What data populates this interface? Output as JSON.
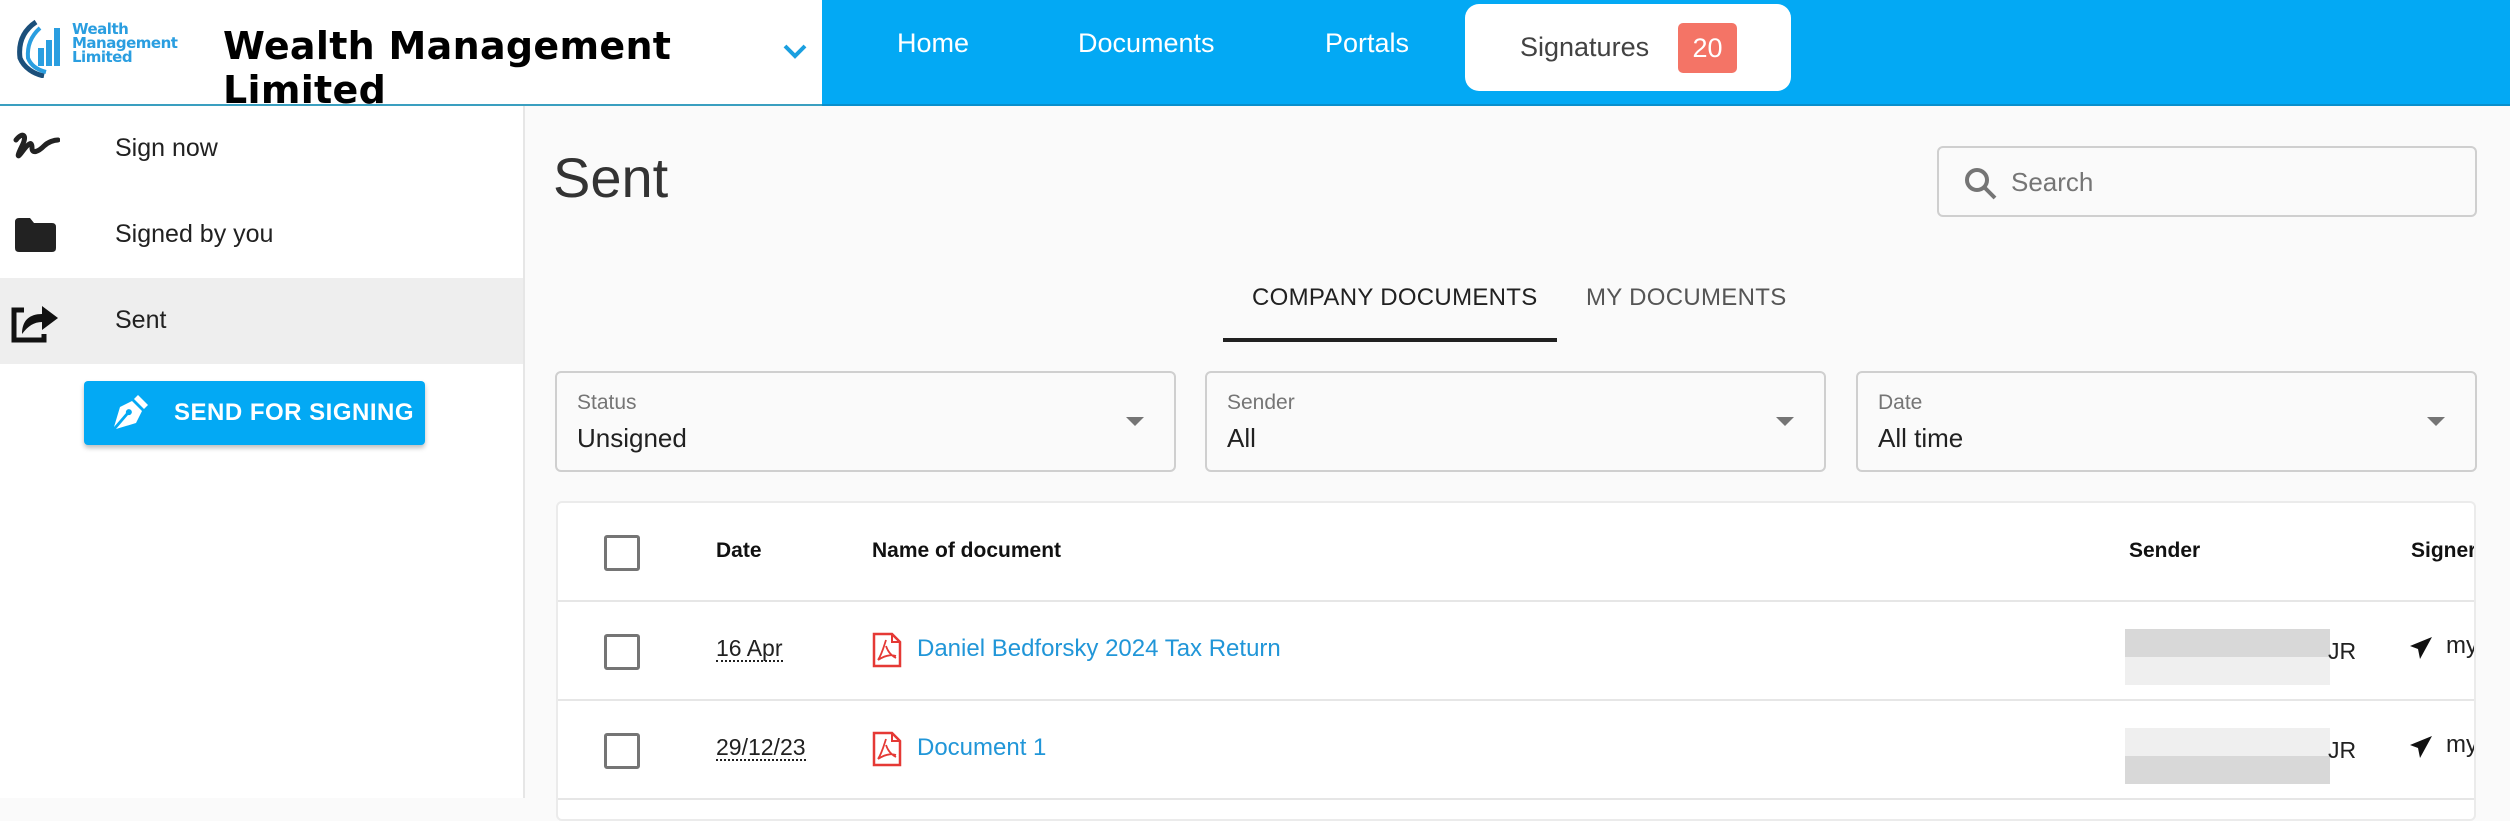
{
  "header": {
    "logo_lines": [
      "Wealth",
      "Management",
      "Limited"
    ],
    "company_name": "Wealth Management Limited",
    "nav": [
      {
        "label": "Home"
      },
      {
        "label": "Documents"
      },
      {
        "label": "Portals"
      },
      {
        "label": "Signatures",
        "badge": "20",
        "active": true
      }
    ]
  },
  "sidebar": {
    "items": [
      {
        "label": "Sign now",
        "icon": "signature-icon"
      },
      {
        "label": "Signed by you",
        "icon": "folder-icon"
      },
      {
        "label": "Sent",
        "icon": "share-icon",
        "active": true
      }
    ],
    "send_button": "SEND FOR SIGNING"
  },
  "main": {
    "title": "Sent",
    "search_placeholder": "Search",
    "tabs": [
      {
        "label": "COMPANY DOCUMENTS",
        "active": true
      },
      {
        "label": "MY DOCUMENTS",
        "active": false
      }
    ],
    "filters": [
      {
        "label": "Status",
        "value": "Unsigned"
      },
      {
        "label": "Sender",
        "value": "All"
      },
      {
        "label": "Date",
        "value": "All time"
      }
    ],
    "table": {
      "columns": [
        "Date",
        "Name of document",
        "Sender",
        "Signers"
      ],
      "rows": [
        {
          "date": "16 Apr",
          "name": "Daniel Bedforsky 2024 Tax Return",
          "sender_visible": "JR",
          "signers": "my"
        },
        {
          "date": "29/12/23",
          "name": "Document 1",
          "sender_visible": "JR",
          "signers": "my"
        }
      ]
    }
  },
  "colors": {
    "accent": "#03a9f4",
    "badge": "#f47466",
    "link": "#2196d8",
    "pdf": "#e53935"
  }
}
